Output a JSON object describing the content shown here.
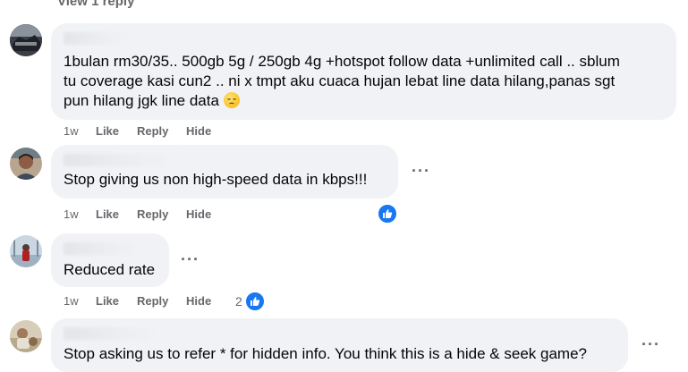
{
  "thread": {
    "view_reply": "View 1 reply"
  },
  "comments": [
    {
      "text_lines": [
        "1bulan rm30/35.. 500gb 5g / 250gb 4g +hotspot follow data +unlimited call .. sblum",
        "tu coverage kasi cun2 .. ni x tmpt aku cuaca hujan lebat line data hilang,panas sgt",
        "pun hilang jgk line data"
      ],
      "emoji": "pensive-face",
      "time": "1w",
      "like": "Like",
      "reply": "Reply",
      "hide": "Hide"
    },
    {
      "text": "Stop giving us non high-speed data in kbps!!!",
      "time": "1w",
      "like": "Like",
      "reply": "Reply",
      "hide": "Hide",
      "reaction": "like"
    },
    {
      "text": "Reduced rate",
      "time": "1w",
      "like": "Like",
      "reply": "Reply",
      "hide": "Hide",
      "reaction_count": "2",
      "reaction": "like"
    },
    {
      "text": "Stop asking us to refer * for hidden info. You think this is a hide & seek game?"
    }
  ],
  "icons": {
    "more": "more-options-icon",
    "like_reaction": "thumbs-up-icon"
  },
  "colors": {
    "bubble": "#f0f2f5",
    "meta_text": "#65676b",
    "like_blue": "#1877f2"
  }
}
